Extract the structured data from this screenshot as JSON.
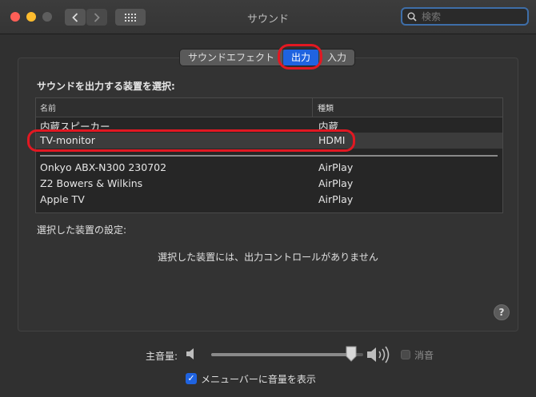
{
  "window": {
    "title": "サウンド"
  },
  "toolbar": {
    "back_icon": "chevron-left-icon",
    "forward_icon": "chevron-right-icon",
    "grid_icon": "grid-icon"
  },
  "search": {
    "placeholder": "検索"
  },
  "tabs": [
    {
      "label": "サウンドエフェクト",
      "selected": false
    },
    {
      "label": "出力",
      "selected": true
    },
    {
      "label": "入力",
      "selected": false
    }
  ],
  "output": {
    "section_title": "サウンドを出力する装置を選択:",
    "columns": {
      "name": "名前",
      "type": "種類"
    },
    "devices": [
      {
        "name": "内蔵スピーカー",
        "type": "内蔵"
      },
      {
        "name": "TV-monitor",
        "type": "HDMI"
      },
      {
        "name": "Onkyo ABX-N300 230702",
        "type": "AirPlay"
      },
      {
        "name": "Z2 Bowers & Wilkins",
        "type": "AirPlay"
      },
      {
        "name": "Apple TV",
        "type": "AirPlay"
      }
    ],
    "selected_device": "TV-monitor",
    "settings_label": "選択した装置の設定:",
    "no_controls_text": "選択した装置には、出力コントロールがありません"
  },
  "help": {
    "label": "?"
  },
  "volume": {
    "label": "主音量:",
    "level_percent": 92,
    "mute_label": "消音",
    "muted": false
  },
  "menubar_option": {
    "label": "メニューバーに音量を表示",
    "checked": true
  },
  "colors": {
    "accent": "#1f63e0",
    "highlight_ring": "#e21822"
  }
}
